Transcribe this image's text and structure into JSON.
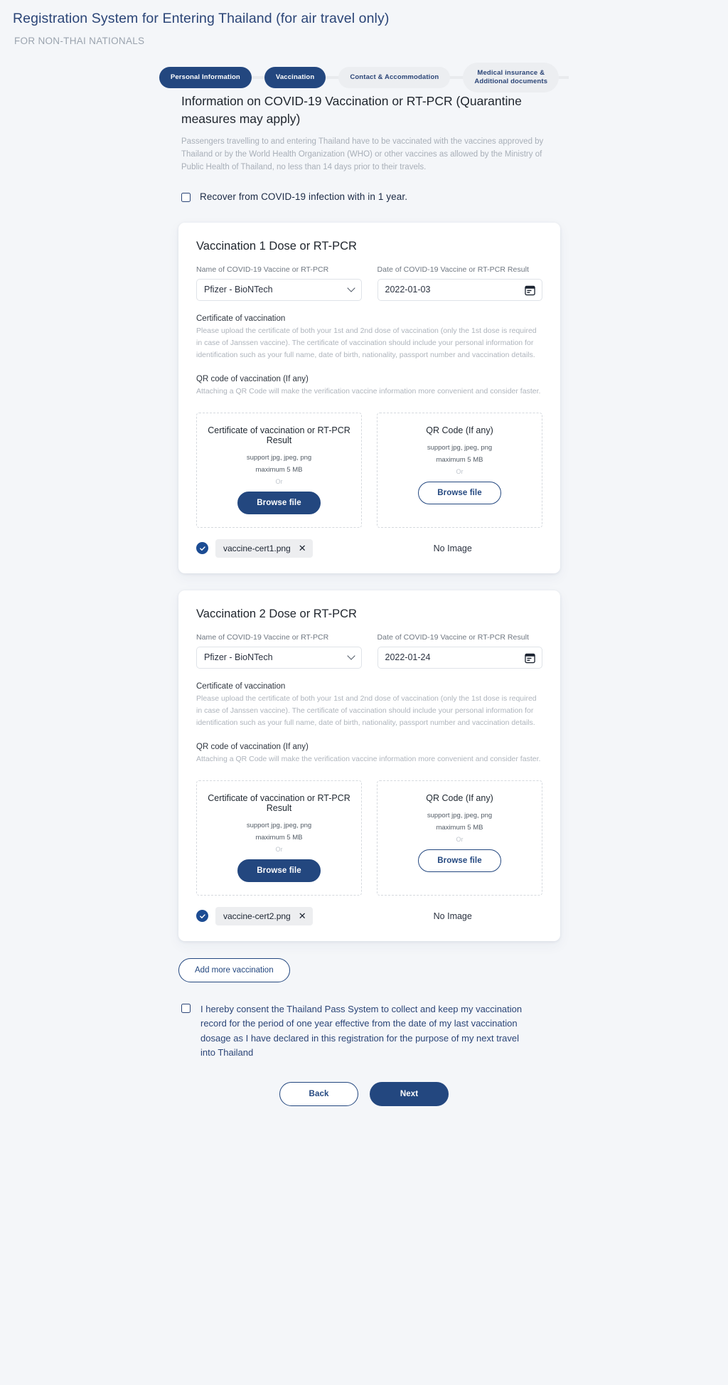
{
  "header": {
    "title": "Registration System for Entering Thailand (for air travel only)",
    "subtitle": "FOR NON-THAI NATIONALS"
  },
  "stepper": {
    "steps": [
      {
        "label": "Personal Information",
        "state": "active"
      },
      {
        "label": "Vaccination",
        "state": "active"
      },
      {
        "label": "Contact & Accommodation",
        "state": "inactive"
      },
      {
        "label": "Medical insurance &\nAdditional documents",
        "state": "inactive"
      }
    ]
  },
  "intro": {
    "title": "Information on COVID-19 Vaccination or RT-PCR (Quarantine measures may apply)",
    "description": "Passengers travelling to and entering Thailand have to be vaccinated with the vaccines approved by Thailand or by the World Health Organization (WHO) or other vaccines as allowed by the Ministry of Public Health of Thailand, no less than 14 days prior to their travels.",
    "recover_checkbox_label": "Recover from COVID-19 infection with in 1 year.",
    "recover_checked": false
  },
  "labels": {
    "vaccine_name_label": "Name of COVID-19 Vaccine or RT-PCR",
    "vaccine_date_label": "Date of COVID-19 Vaccine or RT-PCR Result",
    "certificate_title": "Certificate of vaccination",
    "certificate_desc": "Please upload the certificate of both your 1st and 2nd dose of vaccination (only the 1st dose is required in case of Janssen vaccine). The certificate of vaccination should include your personal information for identification such as your full name, date of birth, nationality, passport number and vaccination details.",
    "qr_title": "QR code of vaccination (If any)",
    "qr_desc": "Attaching a QR Code will make the verification vaccine information more convenient and consider faster.",
    "upload_cert_title": "Certificate of vaccination or RT-PCR Result",
    "upload_qr_title": "QR Code (If any)",
    "support_formats": "support jpg, jpeg, png",
    "max_size": "maximum 5 MB",
    "or": "Or",
    "browse_file": "Browse file",
    "no_image": "No Image"
  },
  "cards": [
    {
      "title": "Vaccination 1 Dose or RT-PCR",
      "vaccine_name": "Pfizer - BioNTech",
      "vaccine_date": "2022-01-03",
      "uploaded_file": "vaccine-cert1.png",
      "qr_status": "No Image"
    },
    {
      "title": "Vaccination 2 Dose or RT-PCR",
      "vaccine_name": "Pfizer - BioNTech",
      "vaccine_date": "2022-01-24",
      "uploaded_file": "vaccine-cert2.png",
      "qr_status": "No Image"
    }
  ],
  "actions": {
    "add_more": "Add more vaccination",
    "back": "Back",
    "next": "Next"
  },
  "consent": {
    "text": "I hereby consent the Thailand Pass System to collect and keep my vaccination record for the period of one year effective from the date of my last vaccination dosage as I have declared in this registration for the purpose of my next travel into Thailand",
    "checked": false
  },
  "colors": {
    "brand_blue": "#23477f",
    "title_blue": "#2b4577",
    "page_bg": "#f4f6f9",
    "card_bg": "#ffffff",
    "muted_text": "#a8afb8",
    "check_blue": "#1c4c93"
  }
}
